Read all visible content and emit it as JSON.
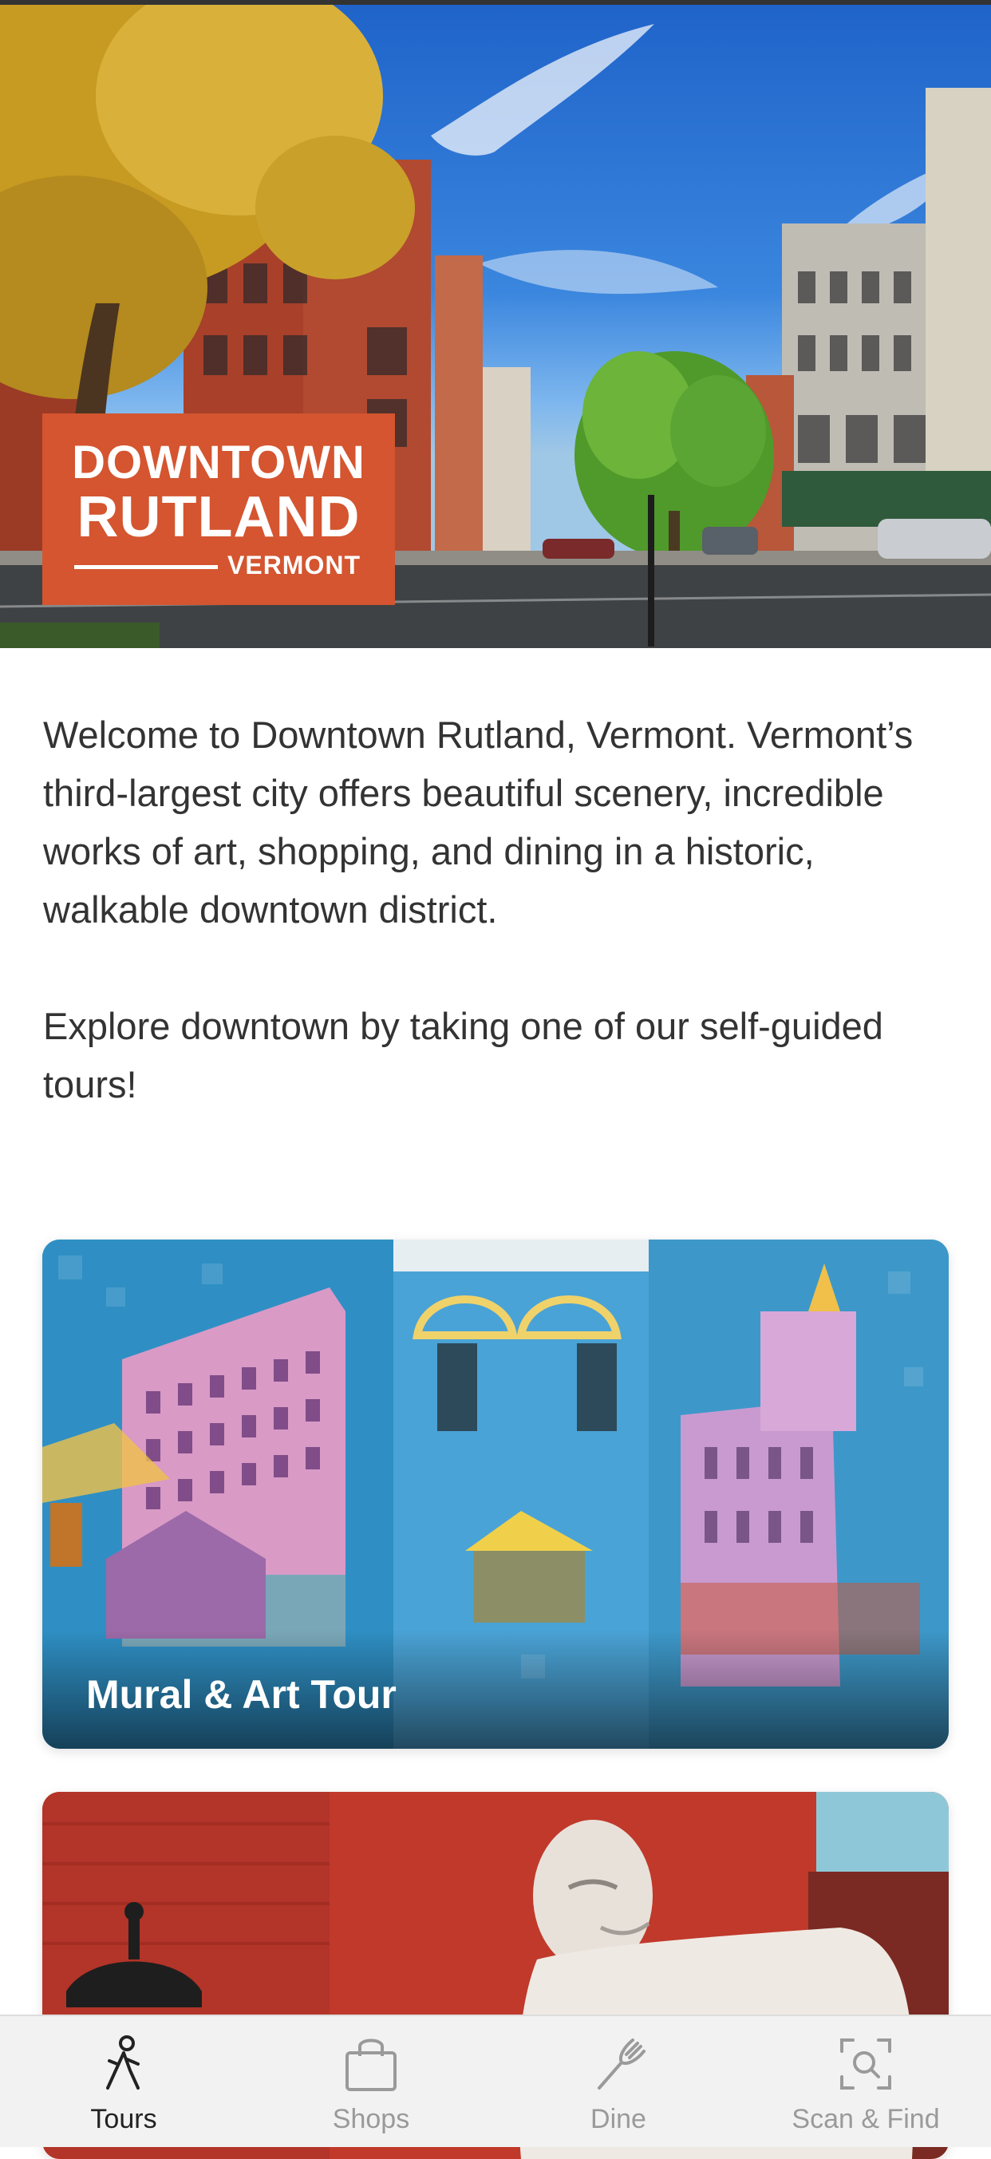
{
  "hero": {
    "logo": {
      "line1": "DOWNTOWN",
      "line2": "RUTLAND",
      "line3": "VERMONT"
    },
    "logo_color": "#d4552f"
  },
  "intro": {
    "paragraph1": "Welcome to Downtown Rutland, Vermont. Vermont’s third-largest city offers beautiful scenery, incredible works of art, shopping, and dining in a historic, walkable downtown district.",
    "paragraph2": "Explore downtown by taking one of our self-guided tours!"
  },
  "tours": [
    {
      "title": "Mural & Art Tour"
    },
    {
      "title": ""
    }
  ],
  "tabbar": {
    "active": "Tours",
    "tabs": [
      {
        "label": "Tours",
        "icon": "walking-person-icon"
      },
      {
        "label": "Shops",
        "icon": "shopping-bag-icon"
      },
      {
        "label": "Dine",
        "icon": "fork-icon"
      },
      {
        "label": "Scan & Find",
        "icon": "scan-search-icon"
      }
    ]
  }
}
